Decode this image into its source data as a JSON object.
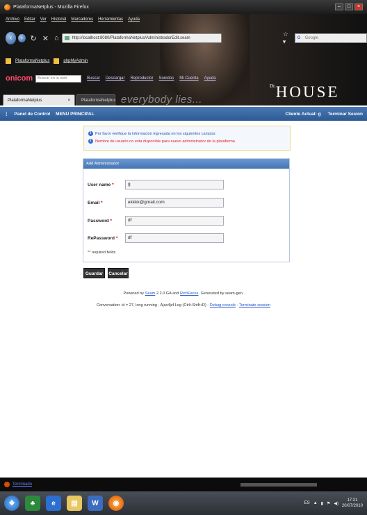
{
  "browser": {
    "window_title": "PlataformaNetplus - Mozilla Firefox",
    "menu": [
      "Archivo",
      "Editar",
      "Ver",
      "Historial",
      "Marcadores",
      "Herramientas",
      "Ayuda"
    ],
    "url": "http://localhost:8080/PlataformaNetplus/AdministradorEdit.seam",
    "search_engine": "Google",
    "bookmarks": [
      "PlataformaNetplus",
      "phpMyAdmin"
    ],
    "toolbar2": {
      "logo": "onicom",
      "search_placeholder": "Buscar en la web",
      "buttons": [
        "Buscar",
        "Descargar",
        "Reproductor",
        "Sonidos",
        "Mi Cuenta",
        "Ayuda"
      ]
    },
    "tabs": [
      "PlataformaNetplus",
      "PlataformaNetplus"
    ],
    "tab_close": "×",
    "theme_text": "everybody lies...",
    "theme_brand": "HOUSE",
    "theme_brand_prefix": "Dr."
  },
  "app": {
    "nav": [
      "Panel de Control",
      "MENU PRINCIPAL"
    ],
    "user_label": "Cliente Actual: g",
    "logout": "Terminar Sesion"
  },
  "messages": {
    "info": "Por favor verifique la informacion ingresada en los siguientes campos:",
    "error": "Nombre de usuario no esta disponible para nuevo administrador de la plataforma"
  },
  "form": {
    "title": "Add Administrador",
    "fields": [
      {
        "label": "User name",
        "value": "g"
      },
      {
        "label": "Email",
        "value": "ekkkk@gmail.com"
      },
      {
        "label": "Password",
        "value": "df"
      },
      {
        "label": "RePassword",
        "value": "df"
      }
    ],
    "required_marker": "*",
    "required_note": "* required fields",
    "save_label": "Guardar",
    "cancel_label": "Cancelar"
  },
  "footer": {
    "powered_prefix": "Powered by",
    "seam": "Seam",
    "version_text": "2.2.0.GA and",
    "richfaces": "RichFaces",
    "generated": ". Generated by seam-gen.",
    "conversation": "Conversation: id = 27, long running - Ajax4jsf Log (Ctrl+Shift+D) -",
    "debug": "Debug console",
    "dash": "-",
    "terminate": "Terminate session"
  },
  "statusbar": {
    "text": "Terminado"
  },
  "taskbar": {
    "language": "ES",
    "time": "17:21",
    "date": "20/07/2010"
  }
}
